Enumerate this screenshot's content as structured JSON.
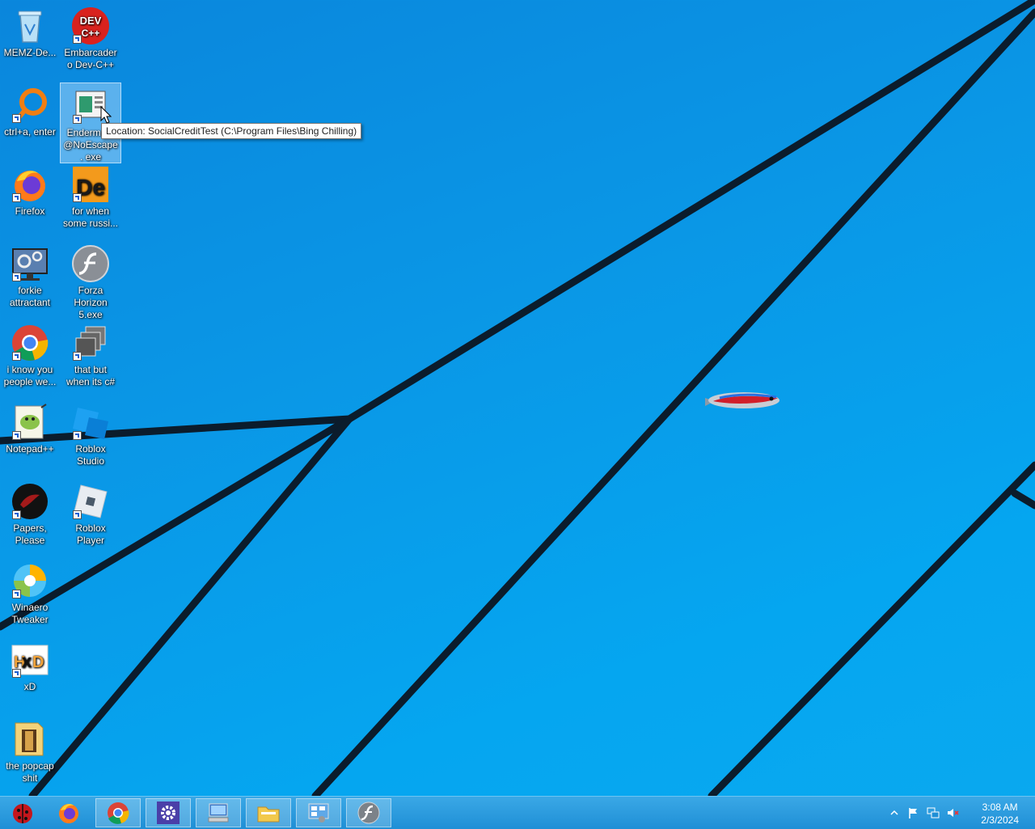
{
  "desktop": {
    "icons": [
      {
        "label": "MEMZ-De...",
        "icon": "recycle-bin-icon"
      },
      {
        "label": "Embarcadero Dev-C++",
        "icon": "devcpp-icon",
        "badge": "DEV C++"
      },
      {
        "label": "ctrl+a, enter",
        "icon": "orange-ring-icon"
      },
      {
        "label": "Enderma... @NoEscape. exe",
        "icon": "window-app-icon"
      },
      {
        "label": "Firefox",
        "icon": "firefox-icon"
      },
      {
        "label": "for when some russi...",
        "icon": "de-app-icon",
        "badge": "De"
      },
      {
        "label": "forkie attractant",
        "icon": "settings-monitor-icon"
      },
      {
        "label": "Forza Horizon 5.exe",
        "icon": "flash-icon"
      },
      {
        "label": "i know you people we...",
        "icon": "chrome-icon"
      },
      {
        "label": "that but when its c#",
        "icon": "stacked-windows-icon"
      },
      {
        "label": "Notepad++",
        "icon": "notepadpp-icon"
      },
      {
        "label": "Roblox Studio",
        "icon": "roblox-studio-icon"
      },
      {
        "label": "Papers, Please",
        "icon": "papers-please-icon"
      },
      {
        "label": "Roblox Player",
        "icon": "roblox-player-icon"
      },
      {
        "label": "Winaero Tweaker",
        "icon": "winaero-icon"
      },
      {
        "label": "xD",
        "icon": "hxd-icon",
        "badge": "HxD"
      },
      {
        "label": "the popcap shit",
        "icon": "folder-icon"
      }
    ],
    "tooltip": "Location: SocialCreditTest (C:\\Program Files\\Bing Chilling)"
  },
  "taskbar": {
    "buttons": [
      {
        "name": "start-orb",
        "icon": "ladybug-orb-icon"
      },
      {
        "name": "firefox",
        "icon": "firefox-icon"
      },
      {
        "name": "chrome",
        "icon": "chrome-icon"
      },
      {
        "name": "settings",
        "icon": "gear-icon"
      },
      {
        "name": "computer",
        "icon": "computer-icon"
      },
      {
        "name": "file-explorer",
        "icon": "folder-icon"
      },
      {
        "name": "control-panel",
        "icon": "control-panel-icon"
      },
      {
        "name": "flash",
        "icon": "flash-icon"
      }
    ],
    "tray": {
      "icons": [
        "show-hidden-icon",
        "action-center-flag-icon",
        "network-icon",
        "volume-muted-icon"
      ],
      "time": "3:08 AM",
      "date": "2/3/2024"
    }
  },
  "colors": {
    "wallpaper": "#0a97e6",
    "wallpaper_lines": "#0b2033",
    "taskbar": "#2a9ce0"
  }
}
